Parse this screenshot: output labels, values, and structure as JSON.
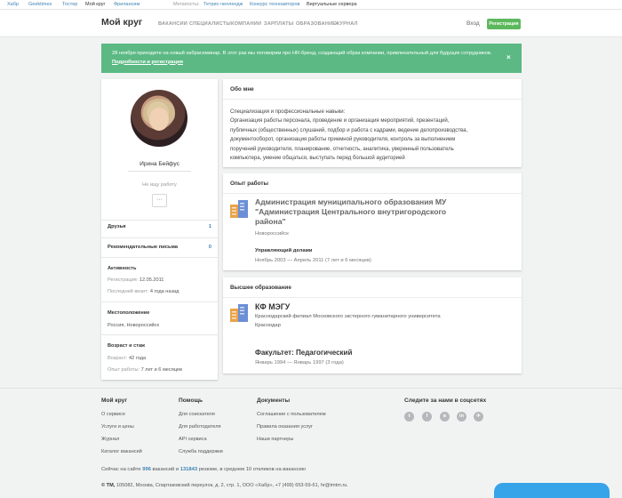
{
  "topbar": {
    "items": [
      "Хабр",
      "Geektimes",
      "Тостер",
      "Мой круг",
      "Фрилансим",
      "Мегапосты:",
      "Тетрис-челлендж",
      "Конкурс техноавторов",
      "Виртуальные сервера"
    ]
  },
  "header": {
    "logo": "Мой круг",
    "nav": [
      "ВАКАНСИИ",
      "СПЕЦИАЛИСТЫ",
      "КОМПАНИИ",
      "ЗАРПЛАТЫ",
      "ОБРАЗОВАНИЕ",
      "ЖУРНАЛ"
    ],
    "login": "Вход",
    "register": "Регистрация"
  },
  "banner": {
    "text": "28 ноября приходите на новый хабрасеминар. В этот раз мы поговорим про HR-бренд, создающий образ компании, привлекательный для будущих сотрудников.",
    "link": "Подробности и регистрация",
    "close": "×"
  },
  "profile": {
    "name": "Ирина Бейфус",
    "status": "Не ищу работу",
    "more": "···",
    "friends_label": "Друзья",
    "friends_count": "1",
    "recs_label": "Рекомендательные письма",
    "recs_count": "0",
    "activity_title": "Активность",
    "reg_label": "Регистрация:",
    "reg_value": "12.05.2011",
    "visit_label": "Последний визит:",
    "visit_value": "4 года назад",
    "location_title": "Местоположение",
    "location_value": "Россия, Новороссийск",
    "age_title": "Возраст и стаж",
    "age_label": "Возраст:",
    "age_value": "42 года",
    "exp_label": "Опыт работы:",
    "exp_value": "7 лет и 6 месяцев"
  },
  "about": {
    "title": "Обо мне",
    "lines": [
      "Специализация и профессиональные навыки:",
      "Организация работы персонала, проведение и организация мероприятий, презентаций,",
      "публичных (общественных) слушаний, подбор и работа с кадрами, ведение делопроизводства,",
      "документооборот, организация работы приемной руководителя, контроль за выполнением",
      "поручений руководителя, планирование, отчетность, аналитика, уверенный пользователь",
      "компьютера, умение общаться, выступать перед большой аудиторией"
    ]
  },
  "experience": {
    "title": "Опыт работы",
    "org_lines": [
      "Администрация муниципального образования МУ",
      "\"Администрация Центрального внутригородского",
      "района\""
    ],
    "city": "Новороссийск",
    "position": "Управляющий делами",
    "period": "Ноябрь 2003 — Апрель 2011 (7 лет и 6 месяцев)"
  },
  "education": {
    "title": "Высшее образование",
    "short": "КФ МЭГУ",
    "full": "Краснодарский филиал Московского экстерного гуманитарного университета",
    "city": "Краснодар",
    "faculty": "Факультет: Педагогический",
    "period": "Январь 1994 — Январь 1997 (3 года)"
  },
  "footer": {
    "col1": {
      "title": "Мой круг",
      "links": [
        "О сервисе",
        "Услуги и цены",
        "Журнал",
        "Каталог вакансий"
      ]
    },
    "col2": {
      "title": "Помощь",
      "links": [
        "Для соискателя",
        "Для работодателя",
        "API сервиса",
        "Служба поддержки"
      ]
    },
    "col3": {
      "title": "Документы",
      "links": [
        "Соглашение с пользователем",
        "Правила оказания услуг",
        "Наши партнеры"
      ]
    },
    "social_title": "Следите за нами в соцсетях",
    "social": [
      "t",
      "f",
      "в",
      "in",
      "✈"
    ],
    "stats_pre": "Сейчас на сайте",
    "stats_vac": "996",
    "stats_mid": "вакансий и",
    "stats_res": "131843",
    "stats_post": "резюме, в среднем 10 откликов на вакансию",
    "copyright_brand": "© ТМ,",
    "copyright": "105082, Москва, Спартаковский переулок, д. 2, стр. 1, ООО «Хабр», +7 (499) 653-59-61, hr@tmtm.ru."
  }
}
